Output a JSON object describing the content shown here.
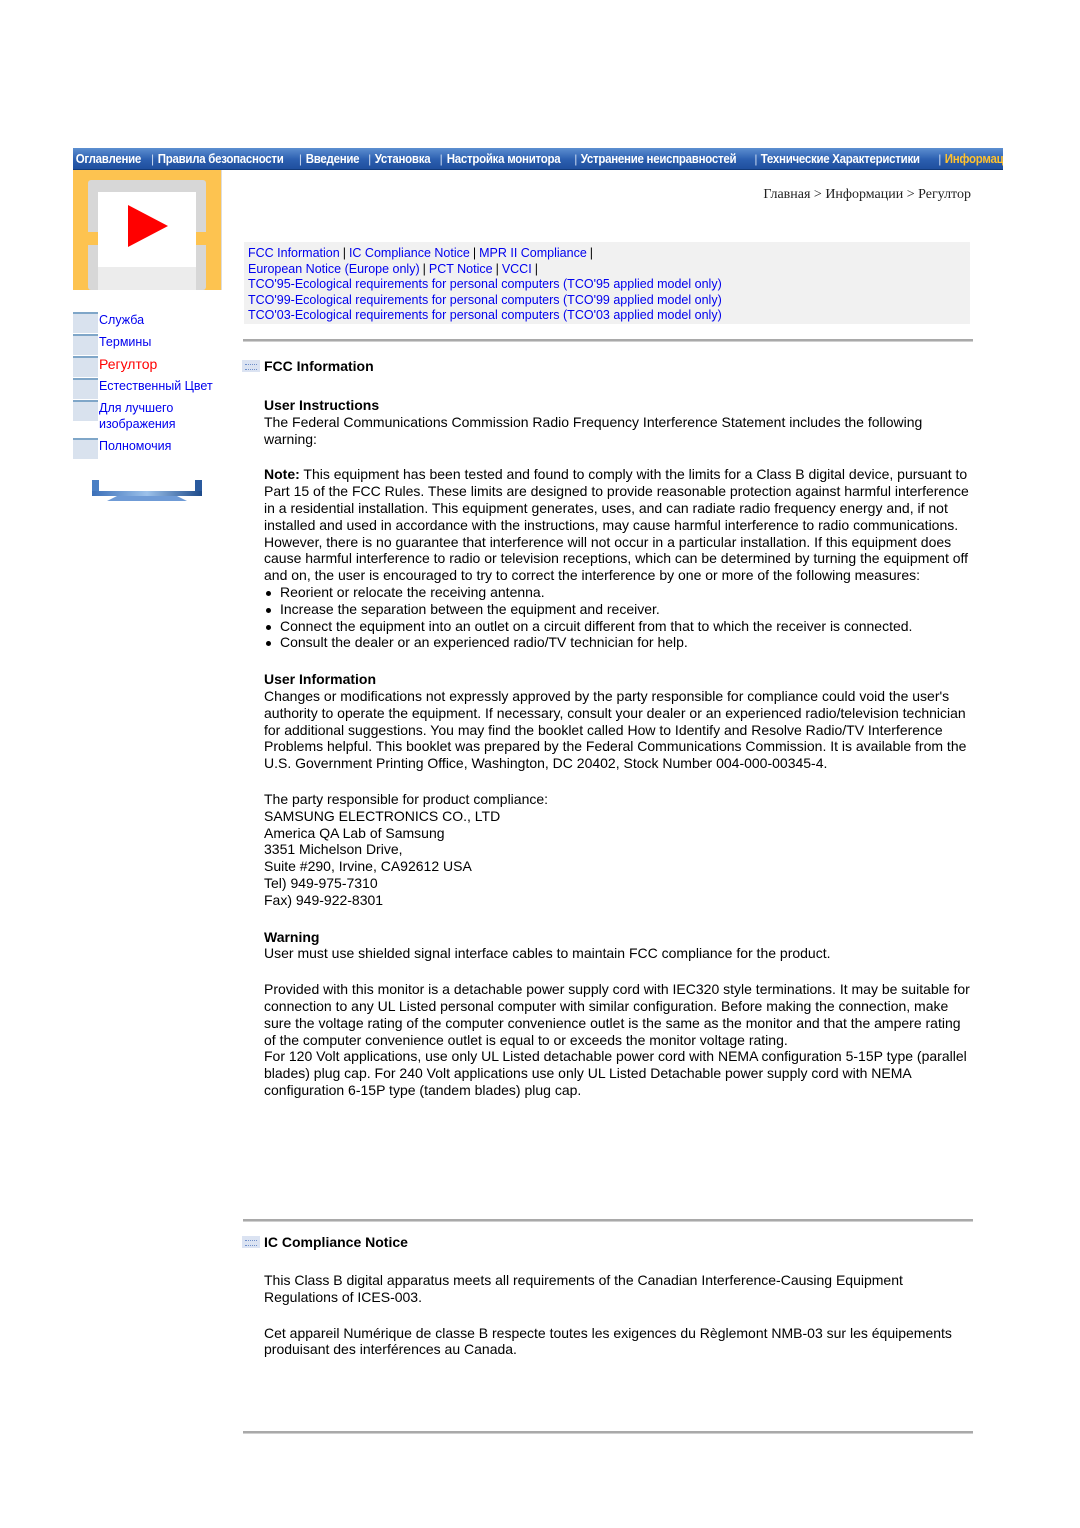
{
  "topnav": {
    "items": [
      {
        "label": "Оглавление",
        "active": false
      },
      {
        "label": "Правила безопасности",
        "active": false
      },
      {
        "label": "Введение",
        "active": false
      },
      {
        "label": "Установка",
        "active": false
      },
      {
        "label": "Настройка монитора",
        "active": false
      },
      {
        "label": "Устранение неисправностей",
        "active": false
      },
      {
        "label": "Технические Характеристики",
        "active": false
      },
      {
        "label": "Информации",
        "active": true
      }
    ],
    "colors": {
      "bar": "#2c5fb0",
      "text": "#ffffff",
      "active": "#ffc12e"
    }
  },
  "logo": {
    "icon": "play-icon",
    "accent": "#fdc350",
    "play_color": "#ff0000"
  },
  "sidebar": {
    "items": [
      {
        "label": "Служба",
        "active": false
      },
      {
        "label": "Термины",
        "active": false
      },
      {
        "label": "Регултор",
        "active": true
      },
      {
        "label": "Естественный Цвет",
        "active": false
      },
      {
        "label": "Для лучшего изображения",
        "active": false
      },
      {
        "label": "Полномочия",
        "active": false
      }
    ],
    "footer_icon": "monitor-stand-icon"
  },
  "breadcrumb": "Главная > Информации > Регултор",
  "links": {
    "row1": [
      "FCC Information",
      "IC Compliance Notice",
      "MPR II Compliance"
    ],
    "row2": [
      "European Notice (Europe only)",
      "PCT Notice",
      "VCCI"
    ],
    "tco": [
      "TCO'95-Ecological requirements for personal computers (TCO'95 applied model only)",
      "TCO'99-Ecological requirements for personal computers (TCO'99 applied model only)",
      "TCO'03-Ecological requirements for personal computers (TCO'03 applied model only)"
    ]
  },
  "fcc": {
    "title": "FCC Information",
    "user_instructions": {
      "heading": "User Instructions",
      "text": "The Federal Communications Commission Radio Frequency Interference Statement includes the following warning:"
    },
    "note": {
      "label": "Note:",
      "text": " This equipment has been tested and found to comply with the limits for a Class B digital device, pursuant to Part 15 of the FCC Rules. These limits are designed to provide reasonable protection against harmful interference in a residential installation. This equipment generates, uses, and can radiate radio frequency energy and, if not installed and used in accordance with the instructions, may cause harmful interference to radio communications. However, there is no guarantee that interference will not occur in a particular installation. If this equipment does cause harmful interference to radio or television receptions, which can be determined by turning the equipment off and on, the user is encouraged to try to correct the interference by one or more of the following measures:"
    },
    "measures": [
      "Reorient or relocate the receiving antenna.",
      "Increase the separation between the equipment and receiver.",
      "Connect the equipment into an outlet on a circuit different from that to which the receiver is connected.",
      "Consult the dealer or an experienced radio/TV technician for help."
    ],
    "user_information": {
      "heading": "User Information",
      "text": "Changes or modifications not expressly approved by the party responsible for compliance could void the user's authority to operate the equipment. If necessary, consult your dealer or an experienced radio/television technician for additional suggestions. You may find the booklet called How to Identify and Resolve Radio/TV Interference Problems helpful. This booklet was prepared by the Federal Communications Commission. It is available from the U.S. Government Printing Office, Washington, DC 20402, Stock Number 004-000-00345-4."
    },
    "party": {
      "intro": "The party responsible for product compliance:",
      "lines": [
        "SAMSUNG ELECTRONICS CO., LTD",
        "America QA Lab of Samsung",
        "3351 Michelson Drive,",
        "Suite #290, Irvine, CA92612 USA",
        "Tel) 949-975-7310",
        "Fax) 949-922-8301"
      ]
    },
    "warning": {
      "heading": "Warning",
      "text": "User must use shielded signal interface cables to maintain FCC compliance for the product."
    },
    "power": {
      "p1": "Provided with this monitor is a detachable power supply cord with IEC320 style terminations. It may be suitable for connection to any UL Listed personal computer with similar configuration. Before making the connection, make sure the voltage rating of the computer convenience outlet is the same as the monitor and that the ampere rating of the computer convenience outlet is equal to or exceeds the monitor voltage rating.",
      "p2": "For 120 Volt applications, use only UL Listed detachable power cord with NEMA configuration 5-15P type (parallel blades) plug cap. For 240 Volt applications use only UL Listed Detachable power supply cord with NEMA configuration 6-15P type (tandem blades) plug cap."
    }
  },
  "ic": {
    "title": "IC Compliance Notice",
    "p1": "This Class B digital apparatus meets all requirements of the Canadian Interference-Causing Equipment Regulations of ICES-003.",
    "p2": "Cet appareil Numérique de classe B respecte toutes les exigences du Règlemont NMB-03 sur les équipements produisant des interférences au Canada."
  }
}
